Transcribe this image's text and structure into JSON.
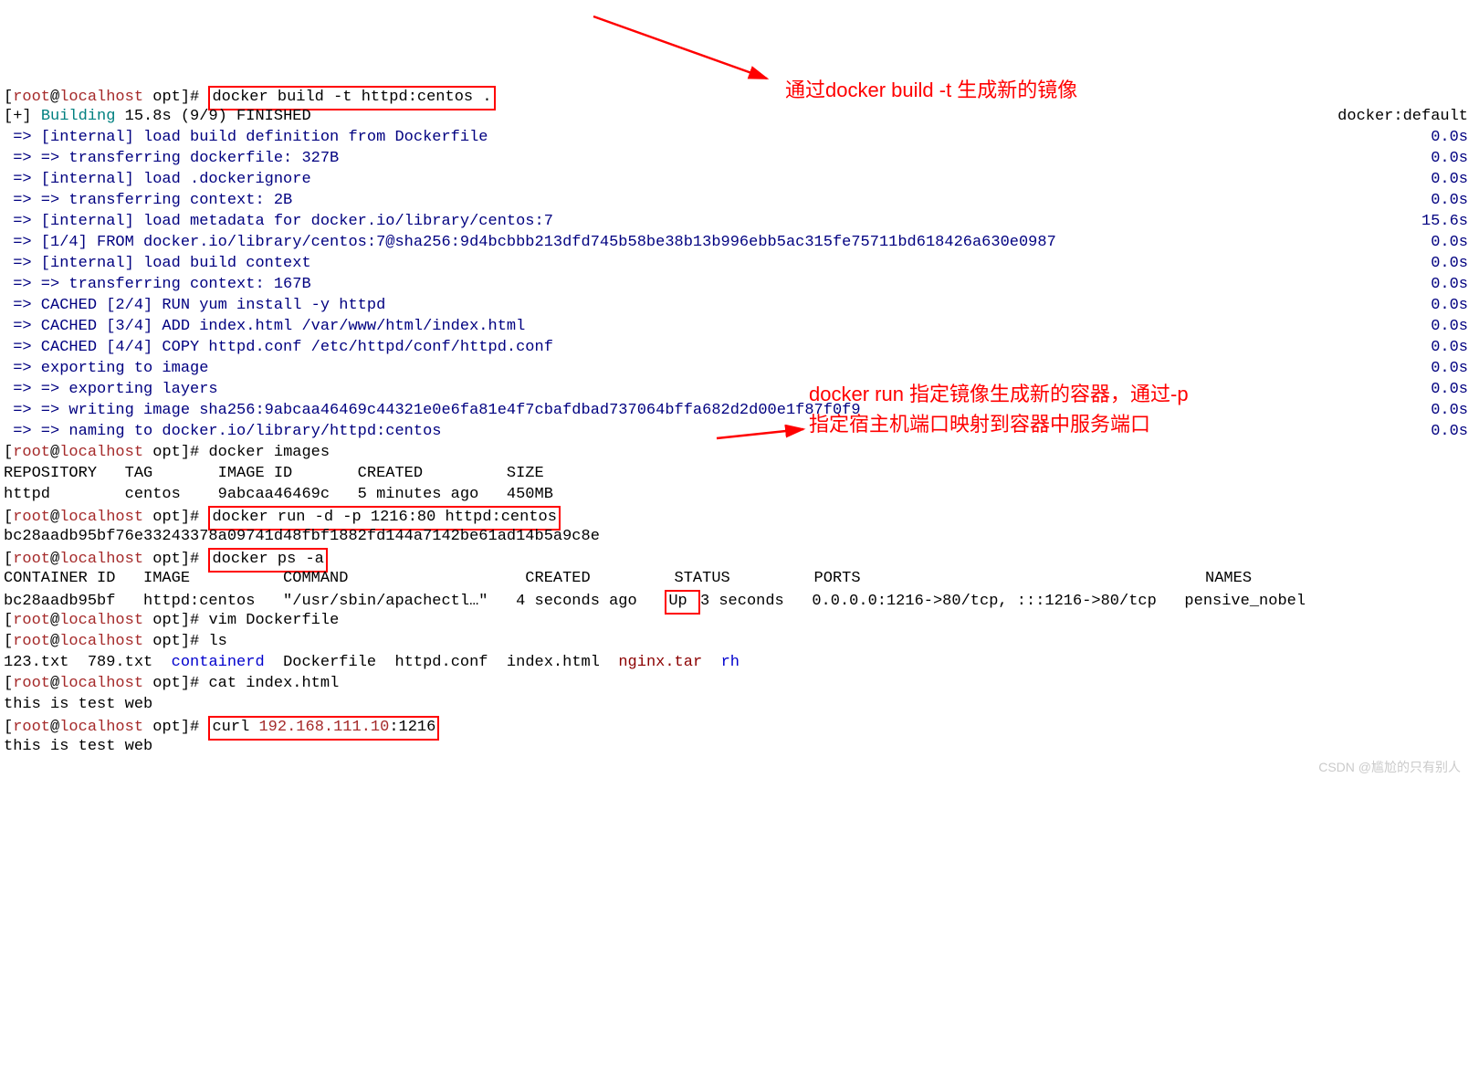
{
  "prompt": {
    "user": "root",
    "at": "@",
    "host": "localhost",
    "path": "opt",
    "end": "]#"
  },
  "cmds": {
    "build": "docker build -t httpd:centos .",
    "images": "docker images",
    "run": "docker run -d -p 1216:80 httpd:centos",
    "psa": "docker ps -a",
    "vim": "vim Dockerfile",
    "ls": "ls",
    "cat": "cat index.html",
    "curl_pre": "curl ",
    "curl_ip": "192.168.111.10",
    "curl_port": ":1216"
  },
  "build": {
    "header_pre": "[+] ",
    "header_building": "Building",
    "header_rest": " 15.8s (9/9) FINISHED",
    "header_right": "docker:default",
    "lines": [
      {
        "l": " => [internal] load build definition from Dockerfile",
        "r": "0.0s"
      },
      {
        "l": " => => transferring dockerfile: 327B",
        "r": "0.0s"
      },
      {
        "l": " => [internal] load .dockerignore",
        "r": "0.0s"
      },
      {
        "l": " => => transferring context: 2B",
        "r": "0.0s"
      },
      {
        "l": " => [internal] load metadata for docker.io/library/centos:7",
        "r": "15.6s"
      },
      {
        "l": " => [1/4] FROM docker.io/library/centos:7@sha256:9d4bcbbb213dfd745b58be38b13b996ebb5ac315fe75711bd618426a630e0987",
        "r": "0.0s"
      },
      {
        "l": " => [internal] load build context",
        "r": "0.0s"
      },
      {
        "l": " => => transferring context: 167B",
        "r": "0.0s"
      },
      {
        "l": " => CACHED [2/4] RUN yum install -y httpd",
        "r": "0.0s"
      },
      {
        "l": " => CACHED [3/4] ADD index.html /var/www/html/index.html",
        "r": "0.0s"
      },
      {
        "l": " => CACHED [4/4] COPY httpd.conf /etc/httpd/conf/httpd.conf",
        "r": "0.0s"
      },
      {
        "l": " => exporting to image",
        "r": "0.0s"
      },
      {
        "l": " => => exporting layers",
        "r": "0.0s"
      },
      {
        "l": " => => writing image sha256:9abcaa46469c44321e0e6fa81e4f7cbafdbad737064bffa682d2d00e1f87f0f9",
        "r": "0.0s"
      },
      {
        "l": " => => naming to docker.io/library/httpd:centos",
        "r": "0.0s"
      }
    ]
  },
  "images_out": {
    "header": "REPOSITORY   TAG       IMAGE ID       CREATED         SIZE",
    "row": "httpd        centos    9abcaa46469c   5 minutes ago   450MB"
  },
  "run_out": "bc28aadb95bf76e33243378a09741d48fbf1882fd144a7142be61ad14b5a9c8e",
  "ps_out": {
    "header": "CONTAINER ID   IMAGE          COMMAND                   CREATED         STATUS         PORTS                                     NAMES",
    "row_pre": "bc28aadb95bf   httpd:centos   \"/usr/sbin/apachectl…\"   4 seconds ago   ",
    "row_up": "Up ",
    "row_post": "3 seconds   0.0.0.0:1216->80/tcp, :::1216->80/tcp   pensive_nobel"
  },
  "ls_out": {
    "p1": "123.txt  789.txt  ",
    "p2": "containerd",
    "p3": "  Dockerfile  httpd.conf  index.html  ",
    "p4": "nginx.tar",
    "p5": "  ",
    "p6": "rh"
  },
  "cat_out": "this is test web",
  "curl_out": "this is test web",
  "annotations": {
    "a1": "通过docker build -t 生成新的镜像",
    "a2": "docker run 指定镜像生成新的容器，通过-p指定宿主机端口映射到容器中服务端口"
  },
  "watermark": "CSDN @尴尬的只有别人"
}
